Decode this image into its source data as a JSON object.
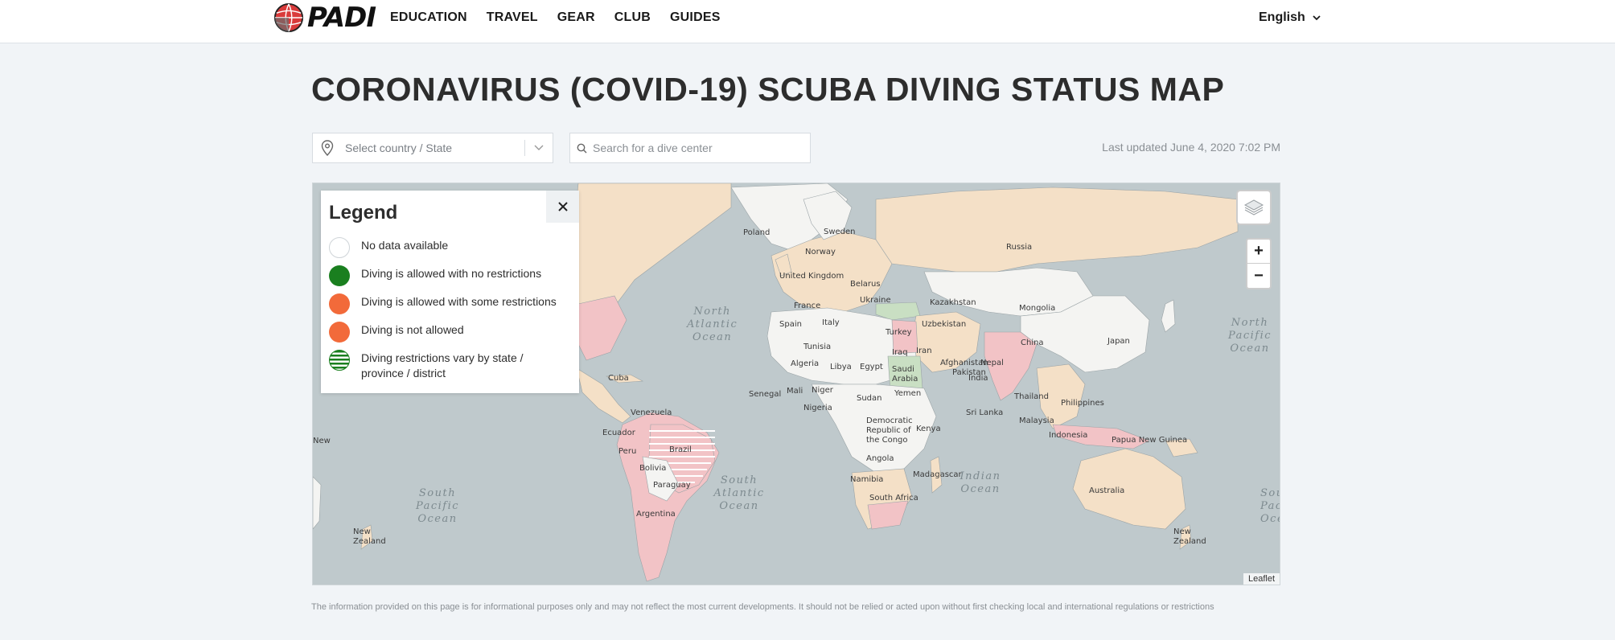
{
  "header": {
    "logo_text": "PADI",
    "nav": [
      "EDUCATION",
      "TRAVEL",
      "GEAR",
      "CLUB",
      "GUIDES"
    ],
    "language": "English"
  },
  "page_title": "CORONAVIRUS (COVID-19) SCUBA DIVING STATUS MAP",
  "filters": {
    "country_placeholder": "Select country / State",
    "dive_center_placeholder": "Search for a dive center",
    "last_updated": "Last updated June 4, 2020 7:02 PM"
  },
  "legend": {
    "title": "Legend",
    "items": [
      {
        "label": "No data available",
        "color": "#ffffff"
      },
      {
        "label": "Diving is allowed with no restrictions",
        "color": "#1a7f1f"
      },
      {
        "label": "Diving is allowed with some restrictions",
        "color": "#f26a3a"
      },
      {
        "label": "Diving is not allowed",
        "color": "#f26a3a"
      },
      {
        "label": "Diving restrictions vary by state / province / district",
        "color": "#1a7f1f"
      }
    ]
  },
  "map": {
    "attribution": "Leaflet",
    "zoom_in": "+",
    "zoom_out": "−",
    "colors": {
      "ocean": "#bfc9cc",
      "no_data": "#f4f4f2",
      "no_restrictions": "#c9dfc3",
      "some_restrictions": "#f4e0c7",
      "not_allowed": "#f2c3c6"
    },
    "ocean_labels": [
      "North Atlantic Ocean",
      "North Pacific Ocean",
      "South Pacific Ocean",
      "South Atlantic Ocean",
      "Indian Ocean",
      "South Pacific Ocean",
      "North Pacific Ocean"
    ],
    "country_labels": [
      "Russia",
      "Sweden",
      "Norway",
      "Poland",
      "United Kingdom",
      "France",
      "Spain",
      "Italy",
      "Ukraine",
      "Belarus",
      "Turkey",
      "Kazakhstan",
      "Mongolia",
      "Uzbekistan",
      "China",
      "Japan",
      "Iran",
      "Iraq",
      "Afghanistan",
      "Pakistan",
      "Nepal",
      "India",
      "Saudi Arabia",
      "Egypt",
      "Libya",
      "Algeria",
      "Tunisia",
      "Mali",
      "Niger",
      "Nigeria",
      "Sudan",
      "Yemen",
      "Senegal",
      "Thailand",
      "Philippines",
      "Sri Lanka",
      "Malaysia",
      "Indonesia",
      "Papua New Guinea",
      "Australia",
      "New Zealand",
      "New Zealand",
      "Kenya",
      "Democratic Republic of the Congo",
      "Angola",
      "Namibia",
      "South Africa",
      "Madagascar",
      "Brazil",
      "Bolivia",
      "Paraguay",
      "Argentina",
      "Peru",
      "Ecuador",
      "Venezuela",
      "Cuba",
      "New"
    ]
  },
  "disclaimer": "The information provided on this page is for informational purposes only and may not reflect the most current developments. It should not be relied or acted upon without first checking local and international regulations or restrictions"
}
